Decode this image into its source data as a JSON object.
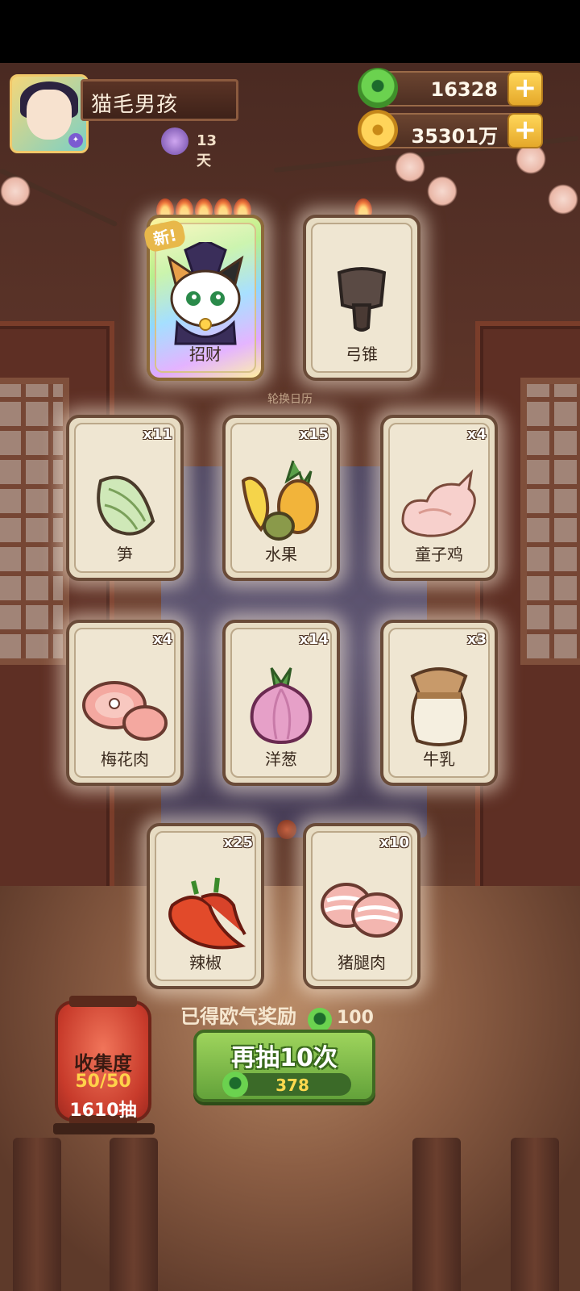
{
  "player": {
    "name": "猫毛男孩",
    "days": "13天"
  },
  "resources": {
    "jade": "16328",
    "gold": "35301万"
  },
  "banner_caption": "轮换日历",
  "new_tag": "新!",
  "cards": [
    {
      "name": "招财",
      "count": "",
      "flames": 5,
      "rare": true
    },
    {
      "name": "弓锥",
      "count": "",
      "flames": 1,
      "rare": false
    },
    {
      "name": "笋",
      "count": "x11"
    },
    {
      "name": "水果",
      "count": "x15"
    },
    {
      "name": "童子鸡",
      "count": "x4"
    },
    {
      "name": "梅花肉",
      "count": "x4"
    },
    {
      "name": "洋葱",
      "count": "x14"
    },
    {
      "name": "牛乳",
      "count": "x3"
    },
    {
      "name": "辣椒",
      "count": "x25"
    },
    {
      "name": "猪腿肉",
      "count": "x10"
    }
  ],
  "reward": {
    "label": "已得欧气奖励",
    "value": "100"
  },
  "draw_button": {
    "label": "再抽10次",
    "cost": "378"
  },
  "collection": {
    "title": "收集度",
    "progress": "50/50",
    "draws": "1610抽"
  }
}
